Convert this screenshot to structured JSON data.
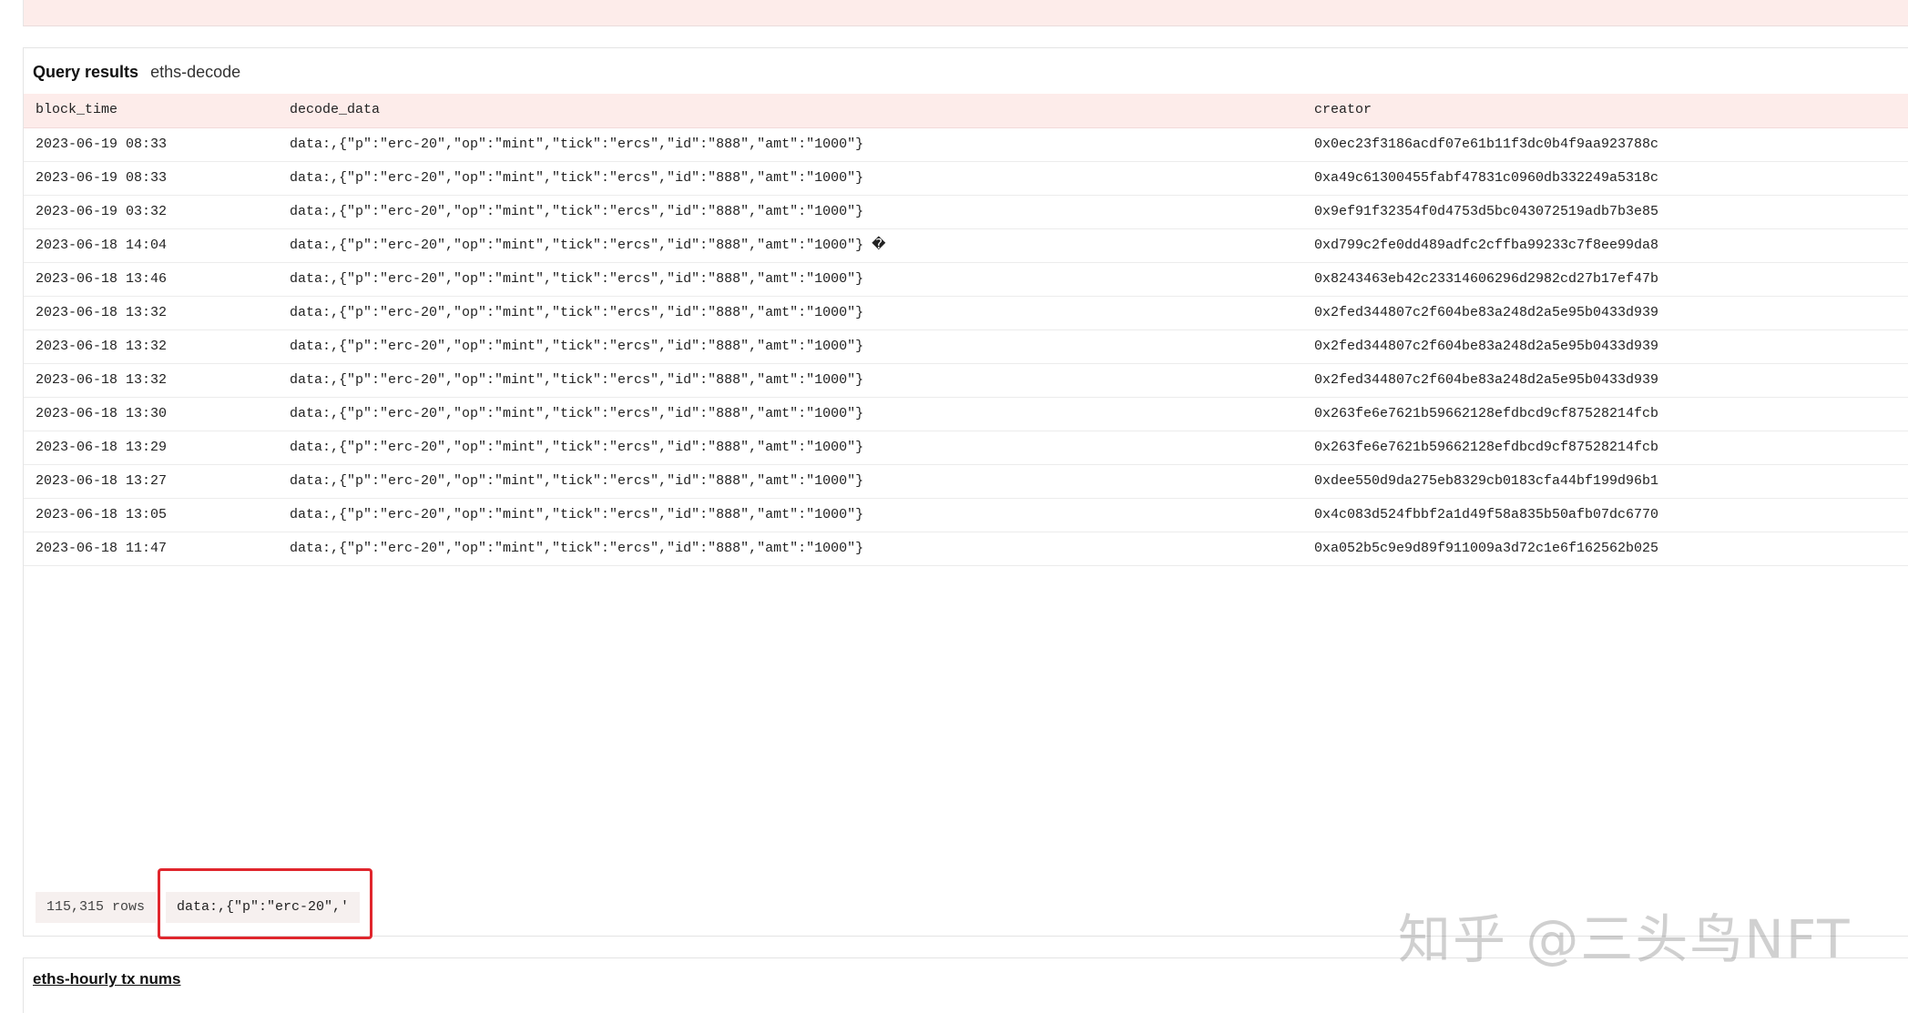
{
  "panel": {
    "title": "Query results",
    "subtitle": "eths-decode"
  },
  "table": {
    "columns": [
      "block_time",
      "decode_data",
      "creator"
    ],
    "rows": [
      [
        "2023-06-19 08:33",
        "data:,{\"p\":\"erc-20\",\"op\":\"mint\",\"tick\":\"ercs\",\"id\":\"888\",\"amt\":\"1000\"}",
        "0x0ec23f3186acdf07e61b11f3dc0b4f9aa923788c"
      ],
      [
        "2023-06-19 08:33",
        "data:,{\"p\":\"erc-20\",\"op\":\"mint\",\"tick\":\"ercs\",\"id\":\"888\",\"amt\":\"1000\"}",
        "0xa49c61300455fabf47831c0960db332249a5318c"
      ],
      [
        "2023-06-19 03:32",
        "data:,{\"p\":\"erc-20\",\"op\":\"mint\",\"tick\":\"ercs\",\"id\":\"888\",\"amt\":\"1000\"}",
        "0x9ef91f32354f0d4753d5bc043072519adb7b3e85"
      ],
      [
        "2023-06-18 14:04",
        "data:,{\"p\":\"erc-20\",\"op\":\"mint\",\"tick\":\"ercs\",\"id\":\"888\",\"amt\":\"1000\"} �",
        "0xd799c2fe0dd489adfc2cffba99233c7f8ee99da8"
      ],
      [
        "2023-06-18 13:46",
        "data:,{\"p\":\"erc-20\",\"op\":\"mint\",\"tick\":\"ercs\",\"id\":\"888\",\"amt\":\"1000\"}",
        "0x8243463eb42c23314606296d2982cd27b17ef47b"
      ],
      [
        "2023-06-18 13:32",
        "data:,{\"p\":\"erc-20\",\"op\":\"mint\",\"tick\":\"ercs\",\"id\":\"888\",\"amt\":\"1000\"}",
        "0x2fed344807c2f604be83a248d2a5e95b0433d939"
      ],
      [
        "2023-06-18 13:32",
        "data:,{\"p\":\"erc-20\",\"op\":\"mint\",\"tick\":\"ercs\",\"id\":\"888\",\"amt\":\"1000\"}",
        "0x2fed344807c2f604be83a248d2a5e95b0433d939"
      ],
      [
        "2023-06-18 13:32",
        "data:,{\"p\":\"erc-20\",\"op\":\"mint\",\"tick\":\"ercs\",\"id\":\"888\",\"amt\":\"1000\"}",
        "0x2fed344807c2f604be83a248d2a5e95b0433d939"
      ],
      [
        "2023-06-18 13:30",
        "data:,{\"p\":\"erc-20\",\"op\":\"mint\",\"tick\":\"ercs\",\"id\":\"888\",\"amt\":\"1000\"}",
        "0x263fe6e7621b59662128efdbcd9cf87528214fcb"
      ],
      [
        "2023-06-18 13:29",
        "data:,{\"p\":\"erc-20\",\"op\":\"mint\",\"tick\":\"ercs\",\"id\":\"888\",\"amt\":\"1000\"}",
        "0x263fe6e7621b59662128efdbcd9cf87528214fcb"
      ],
      [
        "2023-06-18 13:27",
        "data:,{\"p\":\"erc-20\",\"op\":\"mint\",\"tick\":\"ercs\",\"id\":\"888\",\"amt\":\"1000\"}",
        "0xdee550d9da275eb8329cb0183cfa44bf199d96b1"
      ],
      [
        "2023-06-18 13:05",
        "data:,{\"p\":\"erc-20\",\"op\":\"mint\",\"tick\":\"ercs\",\"id\":\"888\",\"amt\":\"1000\"}",
        "0x4c083d524fbbf2a1d49f58a835b50afb07dc6770"
      ],
      [
        "2023-06-18 11:47",
        "data:,{\"p\":\"erc-20\",\"op\":\"mint\",\"tick\":\"ercs\",\"id\":\"888\",\"amt\":\"1000\"}",
        "0xa052b5c9e9d89f911009a3d72c1e6f162562b025"
      ]
    ]
  },
  "footer": {
    "row_count": "115,315 rows",
    "filter_chip": "data:,{\"p\":\"erc-20\",'"
  },
  "next_panel": {
    "title": "eths-hourly tx nums"
  },
  "watermark": {
    "text": "知乎 @三头鸟NFT"
  },
  "colors": {
    "header_bg": "#fdecea",
    "highlight": "#e0262d"
  }
}
